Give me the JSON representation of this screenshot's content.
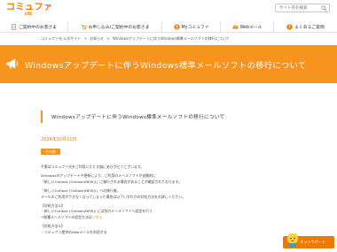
{
  "header": {
    "logo_text": "コミュファ",
    "logo_sub": "ctc",
    "search_placeholder": "サイト内を検索"
  },
  "nav": {
    "items": [
      {
        "label": "ご契約中のお客さま"
      },
      {
        "label": "お申し込み/ご契約中のお客さま"
      },
      {
        "label": "Myコミュファ"
      },
      {
        "label": "Webメール"
      },
      {
        "label": "よくあるご質問"
      }
    ]
  },
  "breadcrumb": [
    "コミュファ光 公式サイト",
    ">",
    "お知らせ",
    ">",
    "Windowsアップデートに伴うWindows標準メールソフトの移行について"
  ],
  "banner": {
    "title": "Windowsアップデートに伴うWindows標準メールソフトの移行について"
  },
  "article": {
    "title": "Windowsアップデートに伴うWindows標準メールソフトの移行について",
    "date": "2024年10月11日",
    "tag": "その他",
    "paragraphs": [
      {
        "lines": [
          "平素はコミュファ光をご利用いただき誠にありがとうございます。"
        ]
      },
      {
        "lines": [
          "Windowsのアップデートや更新により、ご利用のメールソフトが自動的に",
          "「新しいOutlook (Outlook(NEW))」に移行される場合があることが確認されております。"
        ]
      },
      {
        "lines": [
          "「新しいOutlook (Outlook(NEW))」への移行後、",
          "メールのご利用ができなくなってしまった場合は以下いずれかの対処方法をお試しください。"
        ]
      },
      {
        "lines": [
          "【対処方法①】",
          "・新しいOutlook (Outlook(NEW)) には別のメールソフトへ設定を行う",
          "→各種メールソフトの設定方法は"
        ],
        "link": "こちら"
      },
      {
        "lines": [
          "【対処方法②】",
          "・コミュファ提供のWebメールを利用する"
        ]
      }
    ]
  },
  "support": {
    "label": "ネットサポート"
  },
  "colors": {
    "brand_orange": "#f7941d",
    "brand_orange_dark": "#ee7a00"
  }
}
